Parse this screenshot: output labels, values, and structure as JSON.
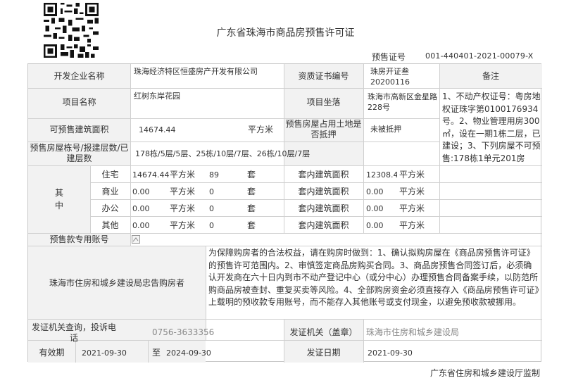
{
  "header": {
    "title": "广东省珠海市商品房预售许可证",
    "permit_label": "预售证号",
    "permit_no": "001-440401-2021-00079-X"
  },
  "labels": {
    "developer": "开发企业名称",
    "qualification": "资质证书编号",
    "remarks": "备注",
    "project_name": "项目名称",
    "location": "项目坐落",
    "presale_area": "可预售建筑面积",
    "land_mortgage": "预售房屋占用土地是否抵押",
    "buildings": "预售房屋栋号/报建层数/已建层数",
    "among": "其",
    "among2": "中",
    "account": "预售款专用账号",
    "notice_title": "珠海市住房和城乡建设局忠告购房者",
    "contact": "发证机关查询，投诉电话",
    "issuer_label": "发证机关（盖章）",
    "valid": "有效期",
    "to": "至",
    "issue_date_label": "发证日期",
    "unit_area": "平方米",
    "unit_set": "套",
    "inner_area": "套内建筑面积"
  },
  "values": {
    "developer": "珠海经济特区恒盛房产开发有限公司",
    "qualification": "珠房开证叁\n20200116",
    "remarks": "1、不动产权证号：粤房地权证珠字第0100176934号。2、物业管理用房300㎡，设在一期1栋二层，已建设；3、下列房屋不可预售:178栋1单元201房",
    "project_name": "红树东岸花园",
    "location": "珠海市高新区金星路228号",
    "presale_area": "14674.44",
    "land_mortgage": "未被抵押",
    "buildings": "178栋/5层/5层、25栋/10层/7层、26栋/10层/7层",
    "contact": "0756-3633356",
    "issuer": "珠海市住房和城乡建设局",
    "valid_from": "2021-09-30",
    "valid_to": "2024-09-30",
    "issue_date": "2021-09-30"
  },
  "usage_rows": [
    {
      "type": "住宅",
      "area": "14674.44",
      "sets": "89",
      "inner": "12308.46"
    },
    {
      "type": "商业",
      "area": "0.00",
      "sets": "0",
      "inner": "0.00"
    },
    {
      "type": "办公",
      "area": "0.00",
      "sets": "0",
      "inner": "0.00"
    },
    {
      "type": "其他",
      "area": "0.00",
      "sets": "0",
      "inner": "0.00"
    }
  ],
  "notice": "为保障购房者的合法权益，请在购房时做到：1、确认拟购房屋在《商品房预售许可证》的预售许可范围内。2、审慎签定商品房购买合同。3、商品房预售合同签订后，必须确认开发商在六十日内到市不动产登记中心（或分中心）办理预售合同备案手续，以防范所购商品房被查封、重复买卖等风险。4、全部购房资金必须直接存入《商品房预售许可证》上载明的预收款专用账号，而不能存入其他账号或支付现金，以避免预收款被挪用。",
  "footer": "广东省住房和城乡建设厅监制"
}
